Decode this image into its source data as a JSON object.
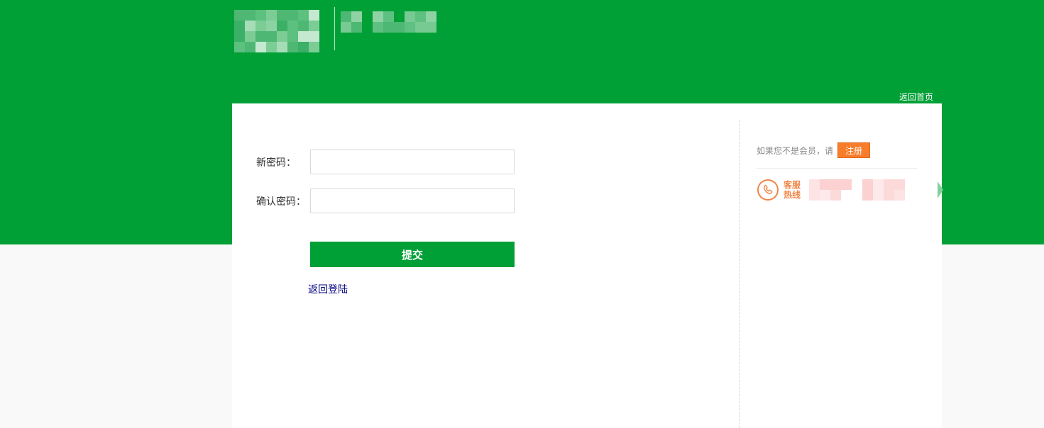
{
  "header": {
    "home_link": "返回首页"
  },
  "form": {
    "new_password_label": "新密码：",
    "confirm_password_label": "确认密码：",
    "new_password_value": "",
    "confirm_password_value": "",
    "submit_label": "提交",
    "back_login_label": "返回登陆"
  },
  "sidebar": {
    "register_prompt": "如果您不是会员，请",
    "register_button": "注册",
    "hotline_label_1": "客服",
    "hotline_label_2": "热线"
  },
  "colors": {
    "brand_green": "#00a037",
    "register_orange": "#f87d2a",
    "hotline_orange": "#f08545",
    "link_navy": "#000080"
  },
  "icons": {
    "phone": "phone-icon"
  }
}
